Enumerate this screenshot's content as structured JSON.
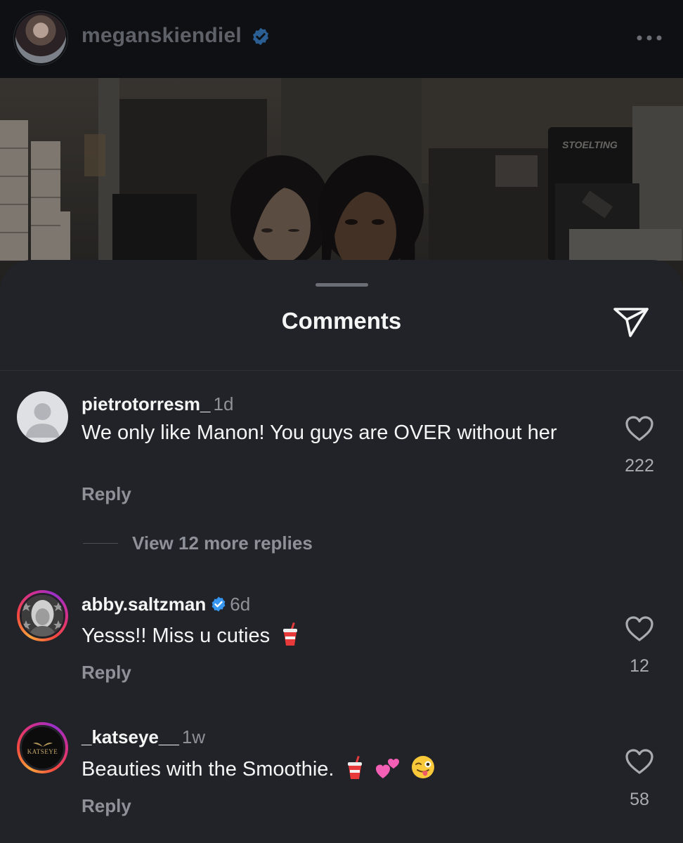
{
  "post": {
    "username": "meganskiendiel",
    "verified": true,
    "photo_sign": "STOELTING"
  },
  "sheet": {
    "title": "Comments"
  },
  "comments": [
    {
      "username": "pietrotorresm_",
      "verified": false,
      "time": "1d",
      "text": "We only like Manon! You guys are OVER without her",
      "reply_label": "Reply",
      "likes": "222",
      "avatar": "default-avatar"
    },
    {
      "username": "abby.saltzman",
      "verified": true,
      "time": "6d",
      "text": "Yesss!! Miss u cuties",
      "emojis": [
        "cup-with-straw"
      ],
      "reply_label": "Reply",
      "likes": "12",
      "avatar": "story-avatar"
    },
    {
      "username": "_katseye__",
      "verified": false,
      "time": "1w",
      "text": "Beauties with the Smoothie.",
      "emojis": [
        "cup-with-straw",
        "two-hearts",
        "winking-face-with-tongue"
      ],
      "reply_label": "Reply",
      "likes": "58",
      "avatar": "story-avatar",
      "avatar_logo_text": "KATSEYE"
    }
  ],
  "replies_thread": {
    "label": "View 12 more replies"
  },
  "colors": {
    "sheet_bg": "#212329",
    "verified_blue": "#3797f0",
    "muted_text": "#8e9197"
  }
}
